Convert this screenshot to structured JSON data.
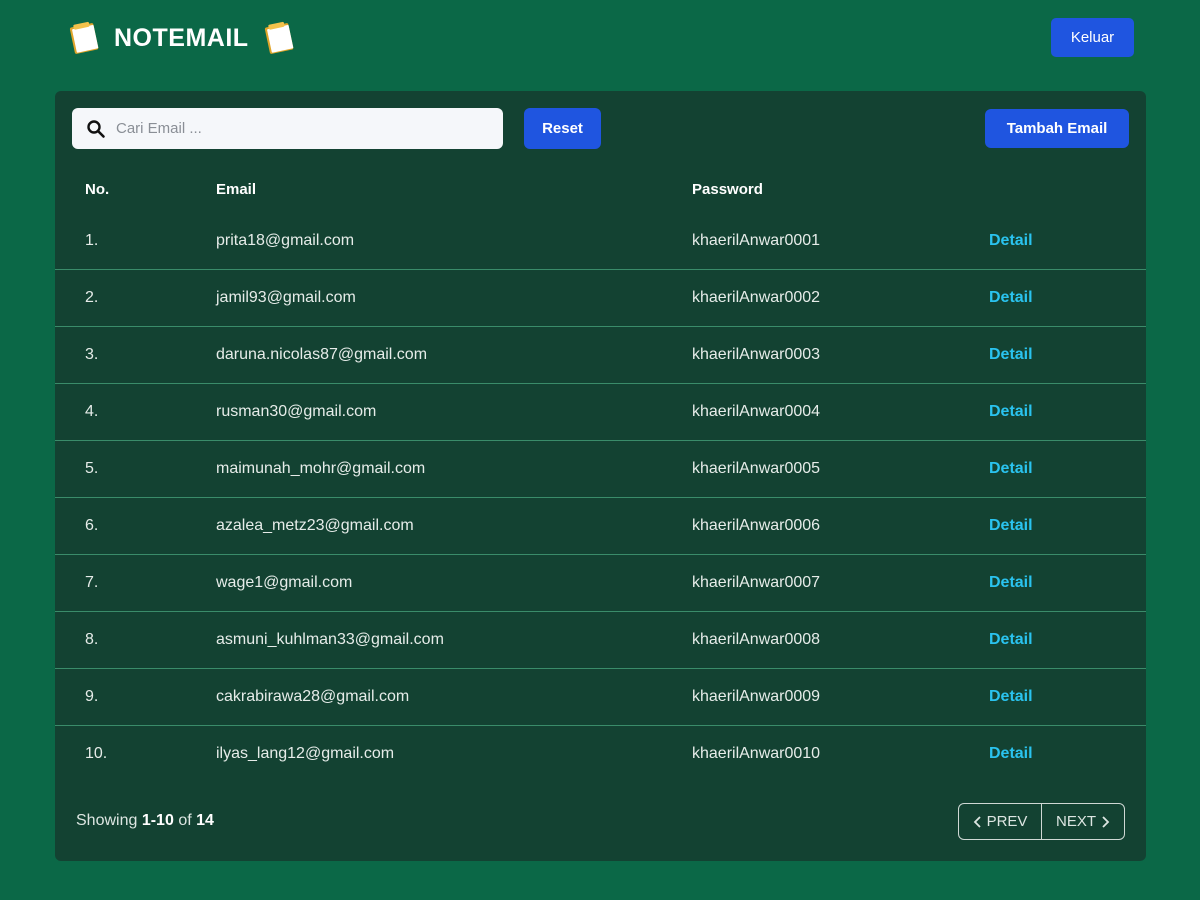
{
  "app": {
    "title": "NOTEMAIL",
    "logo_icon": "notepad-icon",
    "logout_label": "Keluar"
  },
  "toolbar": {
    "search_placeholder": "Cari Email ...",
    "search_value": "",
    "search_icon": "search-icon",
    "reset_label": "Reset",
    "add_label": "Tambah Email"
  },
  "table": {
    "headers": {
      "no": "No.",
      "email": "Email",
      "password": "Password",
      "action": ""
    },
    "rows": [
      {
        "no": "1.",
        "email": "prita18@gmail.com",
        "password": "khaerilAnwar0001",
        "action": "Detail"
      },
      {
        "no": "2.",
        "email": "jamil93@gmail.com",
        "password": "khaerilAnwar0002",
        "action": "Detail"
      },
      {
        "no": "3.",
        "email": "daruna.nicolas87@gmail.com",
        "password": "khaerilAnwar0003",
        "action": "Detail"
      },
      {
        "no": "4.",
        "email": "rusman30@gmail.com",
        "password": "khaerilAnwar0004",
        "action": "Detail"
      },
      {
        "no": "5.",
        "email": "maimunah_mohr@gmail.com",
        "password": "khaerilAnwar0005",
        "action": "Detail"
      },
      {
        "no": "6.",
        "email": "azalea_metz23@gmail.com",
        "password": "khaerilAnwar0006",
        "action": "Detail"
      },
      {
        "no": "7.",
        "email": "wage1@gmail.com",
        "password": "khaerilAnwar0007",
        "action": "Detail"
      },
      {
        "no": "8.",
        "email": "asmuni_kuhlman33@gmail.com",
        "password": "khaerilAnwar0008",
        "action": "Detail"
      },
      {
        "no": "9.",
        "email": "cakrabirawa28@gmail.com",
        "password": "khaerilAnwar0009",
        "action": "Detail"
      },
      {
        "no": "10.",
        "email": "ilyas_lang12@gmail.com",
        "password": "khaerilAnwar0010",
        "action": "Detail"
      }
    ]
  },
  "pagination": {
    "showing_prefix": "Showing",
    "range": "1-10",
    "of_label": "of",
    "total": "14",
    "prev_label": "PREV",
    "next_label": "NEXT"
  },
  "colors": {
    "background": "#0b6847",
    "panel": "#134232",
    "accent_blue": "#1f55e0",
    "link_cyan": "#2ac3ef",
    "row_divider": "#3a8c6a"
  }
}
